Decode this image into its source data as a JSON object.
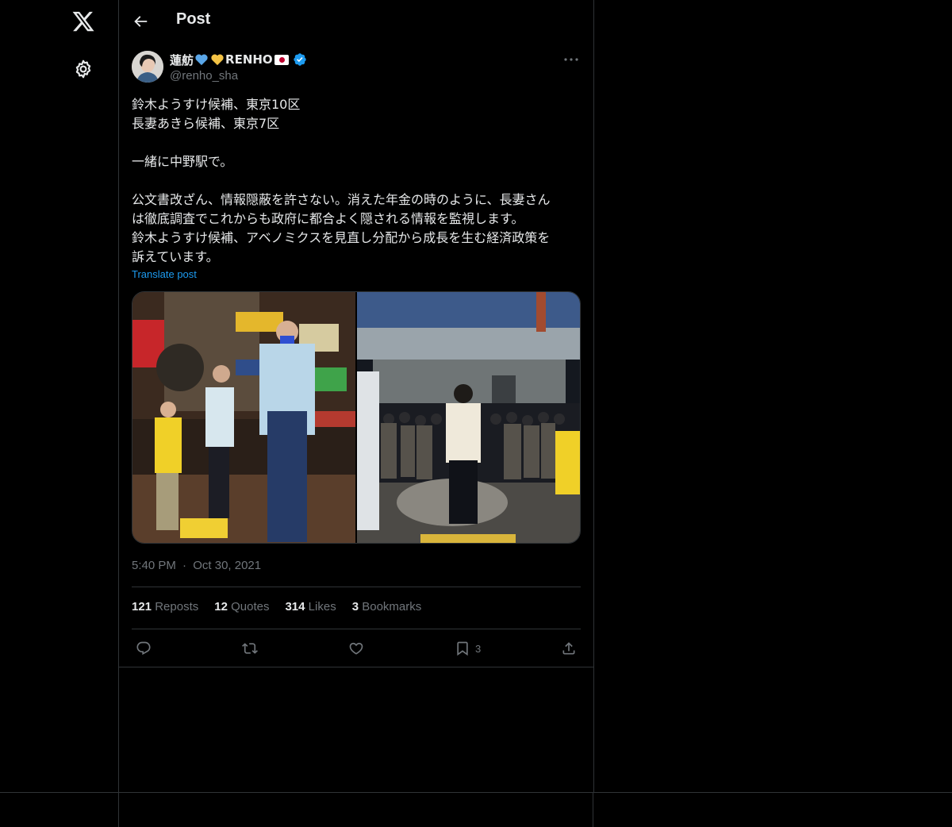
{
  "header": {
    "title": "Post"
  },
  "post": {
    "author_name": "蓮舫",
    "author_name_suffix": "RENHO",
    "author_handle": "@renho_sha",
    "text": "鈴木ようすけ候補、東京10区\n長妻あきら候補、東京7区\n\n一緒に中野駅で。\n\n公文書改ざん、情報隠蔽を許さない。消えた年金の時のように、長妻さん\nは徹底調査でこれからも政府に都合よく隠される情報を監視します。\n鈴木ようすけ候補、アベノミクスを見直し分配から成長を生む経済政策を\n訴えています。",
    "translate_label": "Translate post",
    "time": "5:40 PM",
    "separator": "·",
    "date": "Oct 30, 2021"
  },
  "stats": [
    {
      "count": "121",
      "label": "Reposts"
    },
    {
      "count": "12",
      "label": "Quotes"
    },
    {
      "count": "314",
      "label": "Likes"
    },
    {
      "count": "3",
      "label": "Bookmarks"
    }
  ],
  "actions": {
    "bookmark_count": "3"
  },
  "colors": {
    "background": "#000000",
    "text": "#e7e9ea",
    "secondary": "#71767b",
    "accent": "#1d9bf0",
    "border": "#2f3336"
  },
  "icons": [
    "x-logo-icon",
    "settings-gear-icon",
    "back-arrow-icon",
    "verified-badge-icon",
    "more-icon",
    "reply-icon",
    "repost-icon",
    "like-icon",
    "bookmark-icon",
    "share-icon"
  ]
}
